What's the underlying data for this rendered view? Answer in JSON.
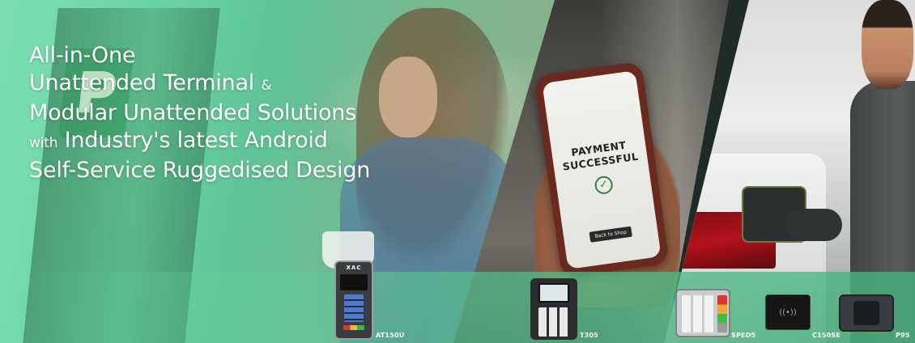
{
  "headline": {
    "line1": "All-in-One",
    "line2_main": "Unattended Terminal",
    "line2_amp": "&",
    "line3": "Modular Unattended Solutions",
    "line4_small": "with",
    "line4_main": "Industry's latest Android",
    "line5": "Self-Service Ruggedised Design"
  },
  "phone": {
    "status_line1": "PAYMENT",
    "status_line2": "SUCCESSFUL",
    "button": "Back to Shop"
  },
  "kiosk_sign": "P",
  "devices": [
    {
      "label": "AT150U",
      "brand": "XAC"
    },
    {
      "label": "T305"
    },
    {
      "label": "SPED5"
    },
    {
      "label": "C150SE"
    },
    {
      "label": "P95"
    }
  ],
  "colors": {
    "overlay_green": "#6bd3a3",
    "strip_green": "#50be87",
    "headline_text": "#ffffff"
  }
}
